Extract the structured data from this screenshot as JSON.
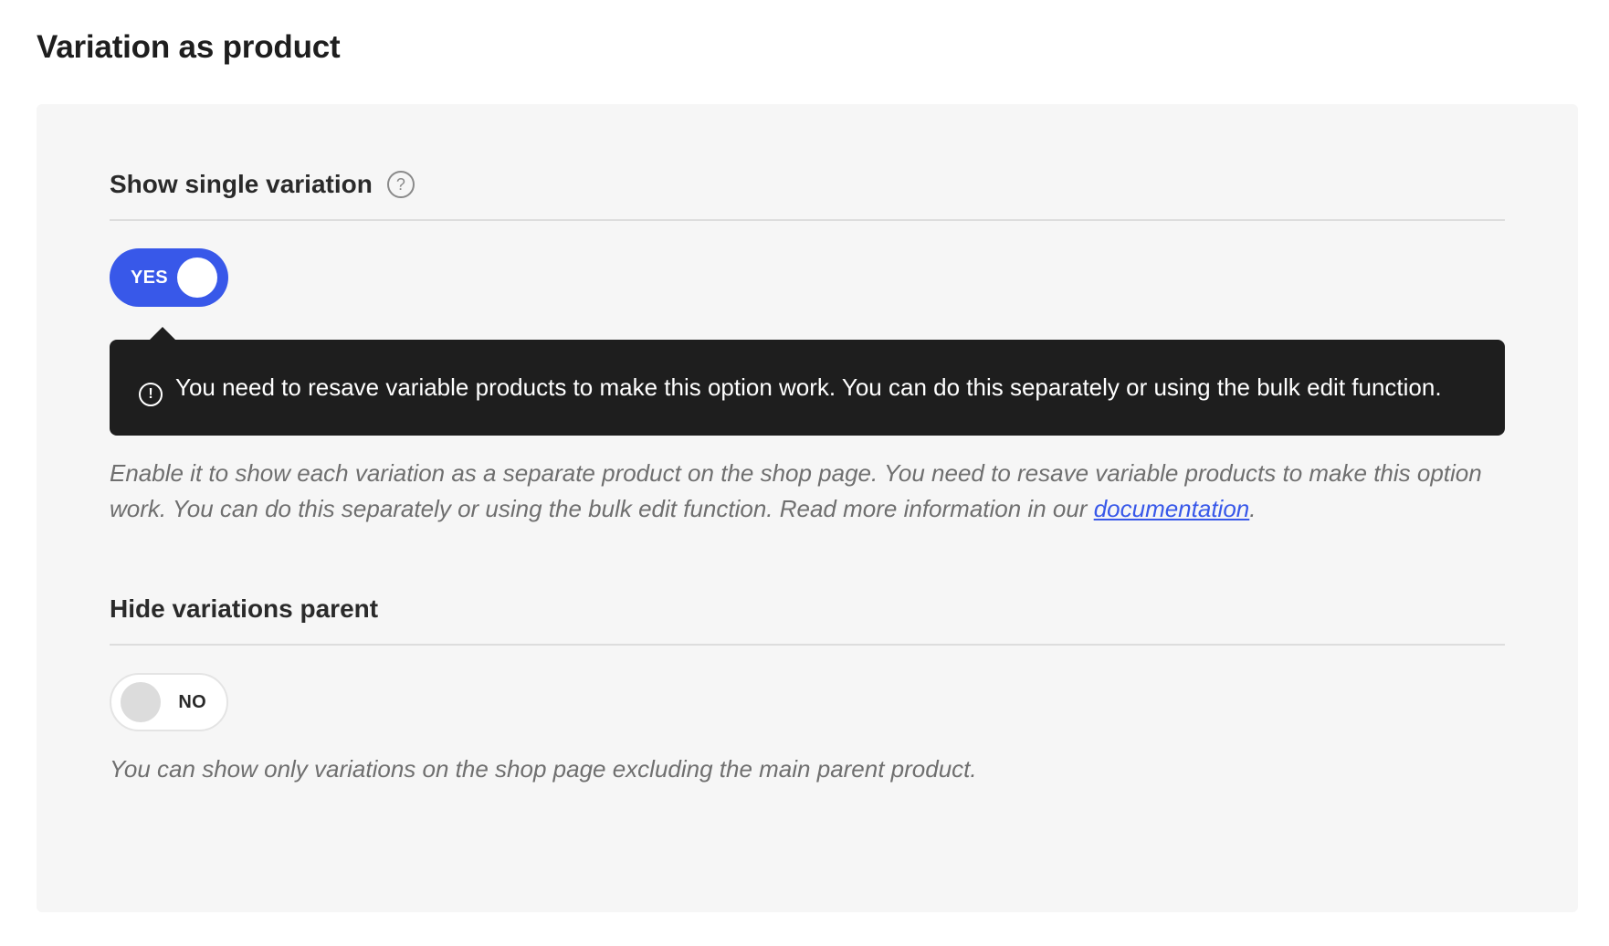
{
  "page": {
    "title": "Variation as product"
  },
  "show_single_variation": {
    "label": "Show single variation",
    "help_icon": "question-circle-icon",
    "toggle_state": "YES",
    "enabled": true,
    "notice": {
      "icon": "exclamation-circle-icon",
      "icon_glyph": "!",
      "text": "You need to resave variable products to make this option work. You can do this separately or using the bulk edit function."
    },
    "description_prefix": "Enable it to show each variation as a separate product on the shop page. You need to resave variable products to make this option work. You can do this separately or using the bulk edit function. Read more information in our ",
    "description_link": "documentation",
    "description_suffix": "."
  },
  "hide_variations_parent": {
    "label": "Hide variations parent",
    "toggle_state": "NO",
    "enabled": false,
    "description": "You can show only variations on the shop page excluding the main parent product."
  },
  "colors": {
    "accent": "#3858e9",
    "notice_bg": "#1e1e1e",
    "panel_bg": "#f6f6f6"
  }
}
